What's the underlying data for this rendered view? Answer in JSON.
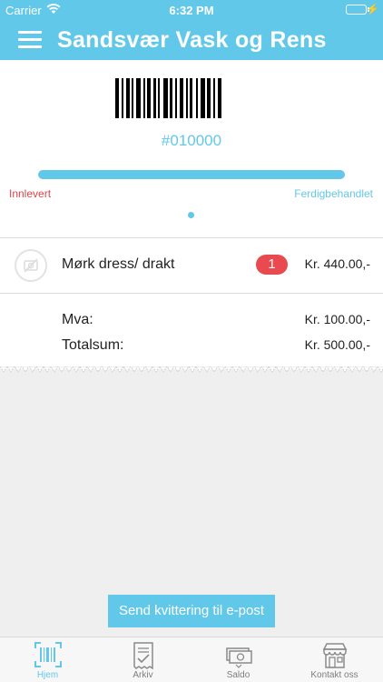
{
  "status_bar": {
    "carrier": "Carrier",
    "time": "6:32 PM",
    "icons": [
      "wifi-icon",
      "battery-icon",
      "charging-icon"
    ]
  },
  "header": {
    "title": "Sandsvær Vask og Rens",
    "menu_icon": "hamburger-icon"
  },
  "order": {
    "number": "#010000",
    "progress": {
      "value": 1.0,
      "start_label": "Innlevert",
      "end_label": "Ferdigbehandlet"
    }
  },
  "items": [
    {
      "name": "Mørk dress/ drakt",
      "quantity": "1",
      "price": "Kr. 440.00,-",
      "icon": "no-image-icon"
    }
  ],
  "summary": {
    "vat_label": "Mva:",
    "vat_value": "Kr. 100.00,-",
    "total_label": "Totalsum:",
    "total_value": "Kr. 500.00,-"
  },
  "actions": {
    "send_receipt": "Send kvittering til e-post"
  },
  "tabs": [
    {
      "label": "Hjem",
      "icon": "barcode-scan-icon",
      "active": true
    },
    {
      "label": "Arkiv",
      "icon": "receipt-check-icon",
      "active": false
    },
    {
      "label": "Saldo",
      "icon": "cash-icon",
      "active": false
    },
    {
      "label": "Kontakt oss",
      "icon": "store-icon",
      "active": false
    }
  ],
  "colors": {
    "accent": "#62c8ea",
    "badge": "#e94a4f",
    "start_label": "#e0454a",
    "background": "#efefef"
  }
}
